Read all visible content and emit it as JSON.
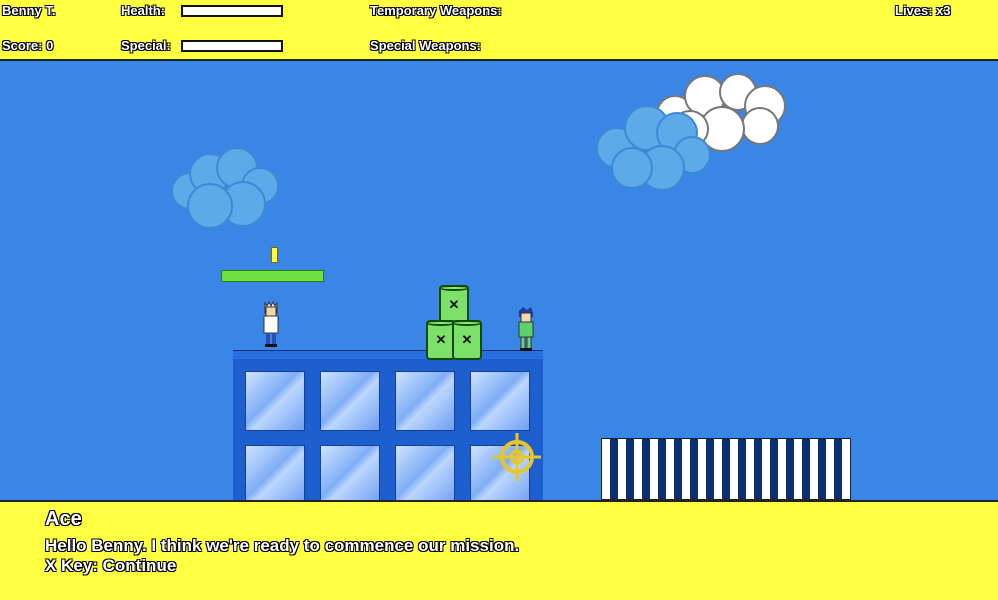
{
  "hud": {
    "player_name": "Benny T.",
    "health_label": "Health:",
    "health_value": 1.0,
    "temporary_weapons_label": "Temporary Weapons:",
    "lives_label": "Lives: x3",
    "score_label": "Score: 0",
    "special_label": "Special:",
    "special_value": 1.0,
    "special_weapons_label": "Special Weapons:"
  },
  "dialog": {
    "speaker": "Ace",
    "message": "Hello Benny. I think we're ready to commence our mission.",
    "prompt": "X Key: Continue"
  },
  "colors": {
    "sky": "#3a86e6",
    "hud_bg": "#ffff41",
    "building": "#1d5fcf",
    "platform": "#70e040",
    "barrel": "#7de06a"
  },
  "icons": {
    "crosshair": "crosshair-icon",
    "barrel_mark": "x-mark-icon"
  }
}
